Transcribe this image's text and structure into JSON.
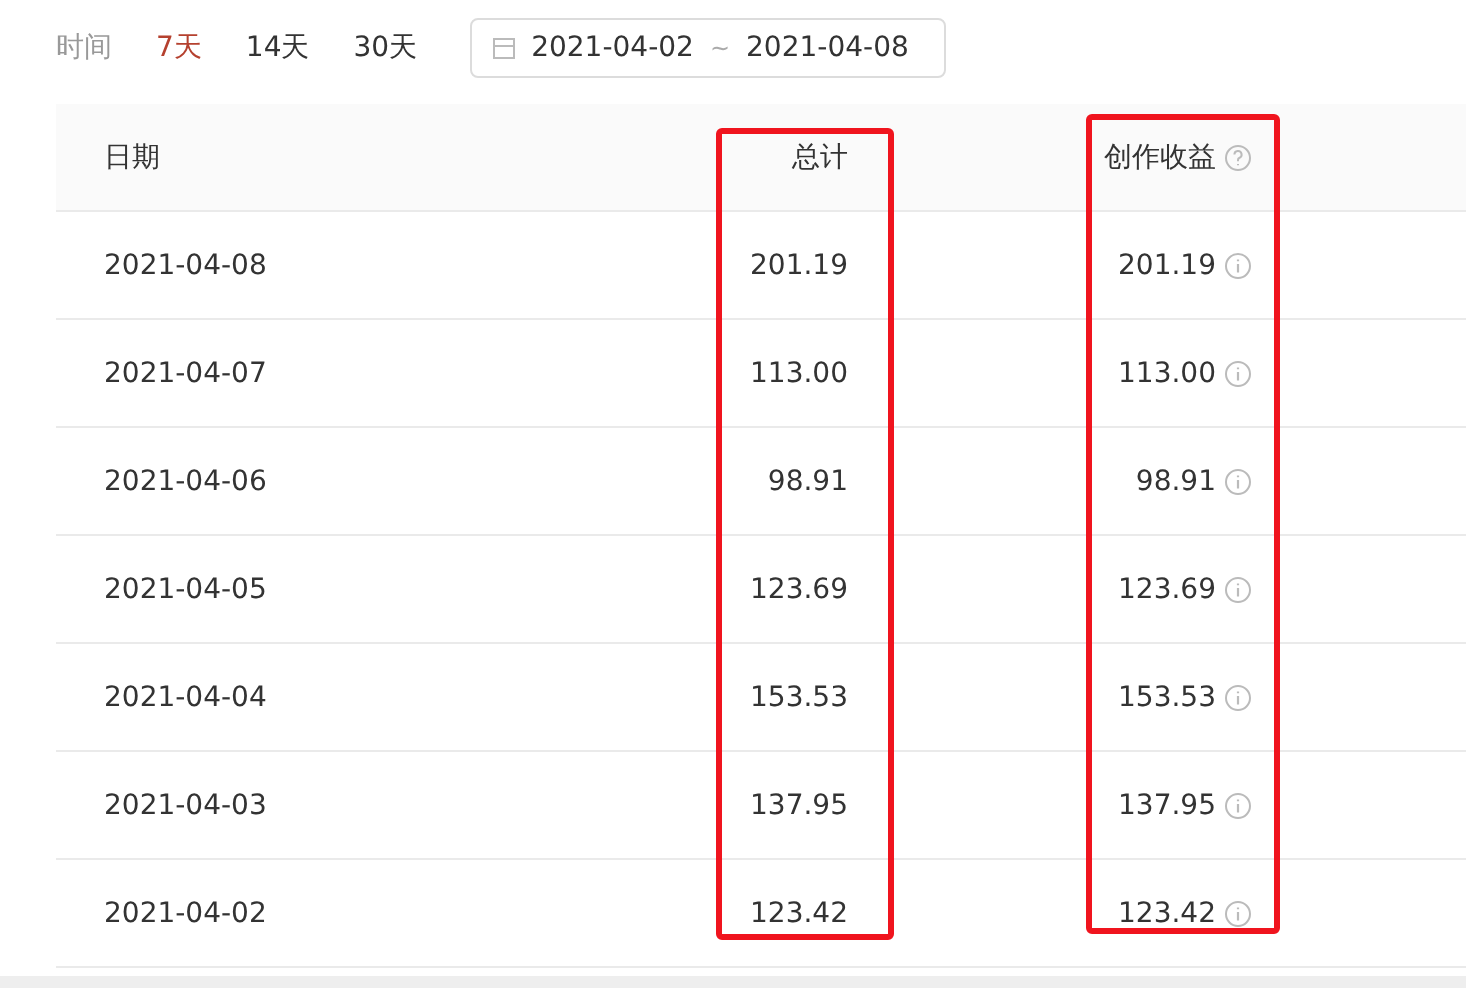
{
  "filter": {
    "label": "时间",
    "ranges": [
      {
        "label": "7天",
        "selected": true
      },
      {
        "label": "14天",
        "selected": false
      },
      {
        "label": "30天",
        "selected": false
      }
    ],
    "date_range": {
      "start": "2021-04-02",
      "separator": "~",
      "end": "2021-04-08"
    }
  },
  "table": {
    "columns": [
      {
        "label": "日期",
        "highlighted": false
      },
      {
        "label": "总计",
        "highlighted": true
      },
      {
        "label": "创作收益",
        "highlighted": true
      }
    ],
    "rows": [
      {
        "date": "2021-04-08",
        "total": "201.19",
        "income": "201.19"
      },
      {
        "date": "2021-04-07",
        "total": "113.00",
        "income": "113.00"
      },
      {
        "date": "2021-04-06",
        "total": "98.91",
        "income": "98.91"
      },
      {
        "date": "2021-04-05",
        "total": "123.69",
        "income": "123.69"
      },
      {
        "date": "2021-04-04",
        "total": "153.53",
        "income": "153.53"
      },
      {
        "date": "2021-04-03",
        "total": "137.95",
        "income": "137.95"
      },
      {
        "date": "2021-04-02",
        "total": "123.42",
        "income": "123.42"
      }
    ]
  }
}
